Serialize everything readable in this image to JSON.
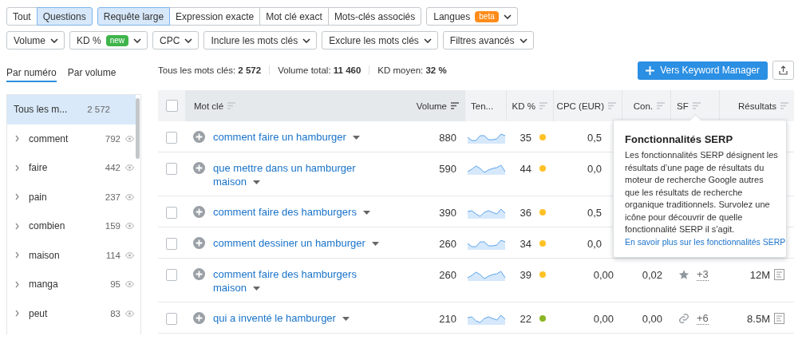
{
  "filters": {
    "match_groups": [
      [
        {
          "label": "Tout",
          "selected": false
        },
        {
          "label": "Questions",
          "selected": true
        }
      ],
      [
        {
          "label": "Requête large",
          "selected": true
        },
        {
          "label": "Expression exacte",
          "selected": false
        },
        {
          "label": "Mot clé exact",
          "selected": false
        },
        {
          "label": "Mots-clés associés",
          "selected": false
        }
      ]
    ],
    "languages": {
      "label": "Langues",
      "badge": "beta"
    },
    "dropdowns": [
      {
        "label": "Volume"
      },
      {
        "label": "KD %",
        "badge": "new"
      },
      {
        "label": "CPC"
      },
      {
        "label": "Inclure les mots clés"
      },
      {
        "label": "Exclure les mots clés"
      },
      {
        "label": "Filtres avancés"
      }
    ]
  },
  "sidebar": {
    "tabs": [
      {
        "label": "Par numéro",
        "selected": true
      },
      {
        "label": "Par volume",
        "selected": false
      }
    ],
    "items": [
      {
        "label": "Tous les m...",
        "count": "2 572",
        "selected": true,
        "kind": "all"
      },
      {
        "label": "comment",
        "count": "792",
        "selected": false,
        "kind": "group"
      },
      {
        "label": "faire",
        "count": "442",
        "selected": false,
        "kind": "group"
      },
      {
        "label": "pain",
        "count": "237",
        "selected": false,
        "kind": "group"
      },
      {
        "label": "combien",
        "count": "159",
        "selected": false,
        "kind": "group"
      },
      {
        "label": "maison",
        "count": "114",
        "selected": false,
        "kind": "group"
      },
      {
        "label": "manga",
        "count": "95",
        "selected": false,
        "kind": "group"
      },
      {
        "label": "peut",
        "count": "83",
        "selected": false,
        "kind": "group"
      }
    ]
  },
  "stats": [
    "Tous les mots clés: **2 572**",
    "Volume total: **11 460**",
    "KD moyen: **32 %**"
  ],
  "keyword_manager_button": "Vers Keyword Manager",
  "table": {
    "header_checked": false,
    "columns": [
      {
        "label": "Mot clé",
        "kind": "sortable"
      },
      {
        "label": "Volume",
        "kind": "sorted"
      },
      {
        "label": "Ten...",
        "kind": "plain"
      },
      {
        "label": "KD %",
        "kind": "sortable"
      },
      {
        "label": "CPC (EUR)",
        "kind": "sortable"
      },
      {
        "label": "Con.",
        "kind": "sortable"
      },
      {
        "label": "SF",
        "kind": "sortable"
      },
      {
        "label": "Résultats",
        "kind": "sortable"
      }
    ],
    "rows": [
      {
        "checked": false,
        "keyword": "comment faire un hamburger",
        "volume": "880",
        "kd": "35",
        "color": "#ffc226",
        "cpc": "0,5"
      },
      {
        "checked": false,
        "keyword": "que mettre dans un hamburger maison",
        "volume": "590",
        "kd": "44",
        "color": "#ffc226",
        "cpc": "0,0"
      },
      {
        "checked": false,
        "keyword": "comment faire des hamburgers",
        "volume": "390",
        "kd": "36",
        "color": "#ffc226",
        "cpc": "0,5"
      },
      {
        "checked": false,
        "keyword": "comment dessiner un hamburger",
        "volume": "260",
        "kd": "34",
        "color": "#ffc226",
        "cpc": "0,0"
      },
      {
        "checked": false,
        "keyword": "comment faire des hamburgers maison",
        "volume": "260",
        "kd": "39",
        "color": "#ffc226",
        "cpc": "0,00",
        "con": "0,02",
        "sf": {
          "kind": "star",
          "extra": "+3"
        },
        "results": "12M"
      },
      {
        "checked": false,
        "keyword": "qui a inventé le hamburger",
        "volume": "210",
        "kd": "22",
        "color": "#8bb524",
        "cpc": "0,00",
        "con": "0,00",
        "sf": {
          "kind": "link",
          "extra": "+6"
        },
        "results": "8.5M"
      }
    ]
  },
  "tooltip": {
    "title": "Fonctionnalités SERP",
    "text": "Les fonctionnalités SERP désignent les résultats d’une page de résultats du moteur de recherche Google autres que les résultats de recherche organique traditionnels. Survolez une icône pour découvrir de quelle fonctionnalité SERP il s’agit.",
    "link": "En savoir plus sur les fonctionnalités SERP"
  }
}
